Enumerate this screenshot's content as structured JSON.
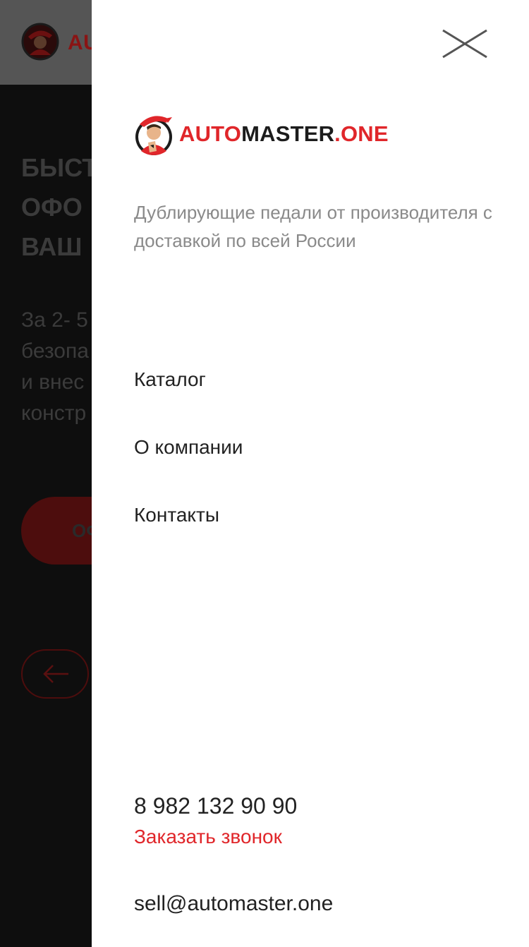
{
  "background": {
    "logo_text": "AU",
    "hero_title": "БЫСТ\nОФО\nВАШ",
    "hero_text": "За 2- 5\nбезопа\nи внес\nконстр",
    "cta_label": "ОФ"
  },
  "drawer": {
    "brand": {
      "part1": "AUTO",
      "part2": "MASTER",
      "part3": ".ONE"
    },
    "tagline": "Дублирующие педали от производителя с доставкой по всей России",
    "nav": [
      {
        "label": "Каталог"
      },
      {
        "label": "О компании"
      },
      {
        "label": "Контакты"
      }
    ],
    "contacts": {
      "phone": "8 982 132 90 90",
      "callback_label": "Заказать звонок",
      "email": "sell@automaster.one"
    }
  },
  "icons": {
    "close": "close-icon",
    "back_arrow": "arrow-left-icon",
    "mascot": "mascot-logo-icon"
  },
  "colors": {
    "accent": "#e0262a",
    "text": "#222222",
    "muted": "#8a8a8a",
    "overlay": "#111111"
  }
}
